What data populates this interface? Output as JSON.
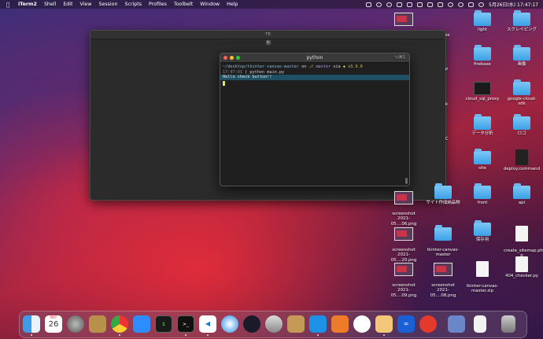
{
  "menubar": {
    "app_name": "iTerm2",
    "menus": [
      "Shell",
      "Edit",
      "View",
      "Session",
      "Scripts",
      "Profiles",
      "Toolbelt",
      "Window",
      "Help"
    ],
    "clock": "5月26日(水)  17:47:17"
  },
  "background_window": {
    "title": "TE"
  },
  "python_window": {
    "title": "python",
    "shortcut": "⌥⌘1",
    "prompt_path": "~/desktop/tkinter-canvas-master",
    "prompt_on": " on ",
    "prompt_branch": "master",
    "prompt_via": " via ",
    "prompt_version": "v3.9.0",
    "prompt_time": "17:47:01",
    "command": " ) python main.py",
    "output_line": "Hello check button!!"
  },
  "desktop_icons": [
    {
      "label": "light",
      "kind": "folder"
    },
    {
      "label": "スクレイピング",
      "kind": "folder"
    },
    {
      "label": "firebase",
      "kind": "folder"
    },
    {
      "label": "画像",
      "kind": "folder"
    },
    {
      "label": "cloud_sql_proxy",
      "kind": "exec"
    },
    {
      "label": "google-cloud-sdk",
      "kind": "folder"
    },
    {
      "label": "データ分析",
      "kind": "folder"
    },
    {
      "label": "ロゴ",
      "kind": "folder"
    },
    {
      "label": "site",
      "kind": "folder"
    },
    {
      "label": "deploy.command",
      "kind": "doc"
    },
    {
      "label": "サイト作成納品物",
      "kind": "folder"
    },
    {
      "label": "front",
      "kind": "folder"
    },
    {
      "label": "api",
      "kind": "folder"
    },
    {
      "label": "screenshot\n2021-05....06.png",
      "kind": "thumb"
    },
    {
      "label": "tkinter-canvas-\nmaster",
      "kind": "folder"
    },
    {
      "label": "保存用",
      "kind": "folder"
    },
    {
      "label": "create_sitemap.ph\np",
      "kind": "doc"
    },
    {
      "label": "screenshot\n2021-05....20.png",
      "kind": "thumb"
    },
    {
      "label": "screenshot\n2021-05....09.png",
      "kind": "thumb"
    },
    {
      "label": "screenshot\n2021-05....08.png",
      "kind": "thumb"
    },
    {
      "label": "tkinter-canvas-\nmaster.zip",
      "kind": "doc"
    },
    {
      "label": "404_checker.py",
      "kind": "doc"
    }
  ],
  "partial_labels": [
    "ss",
    "P",
    "k",
    "C"
  ],
  "dock": {
    "calendar_day": "26",
    "calendar_month": "MAY",
    "apps": [
      "finder",
      "calendar",
      "system-preferences",
      "archive-utility",
      "chrome",
      "zoom",
      "activity-monitor",
      "terminal",
      "vscode",
      "safari",
      "proxyman",
      "sequel",
      "scripteditor",
      "docker",
      "sourcetree",
      "postgres",
      "preview",
      "loop",
      "clock",
      "screenshot-folder",
      "document",
      "trash"
    ]
  }
}
